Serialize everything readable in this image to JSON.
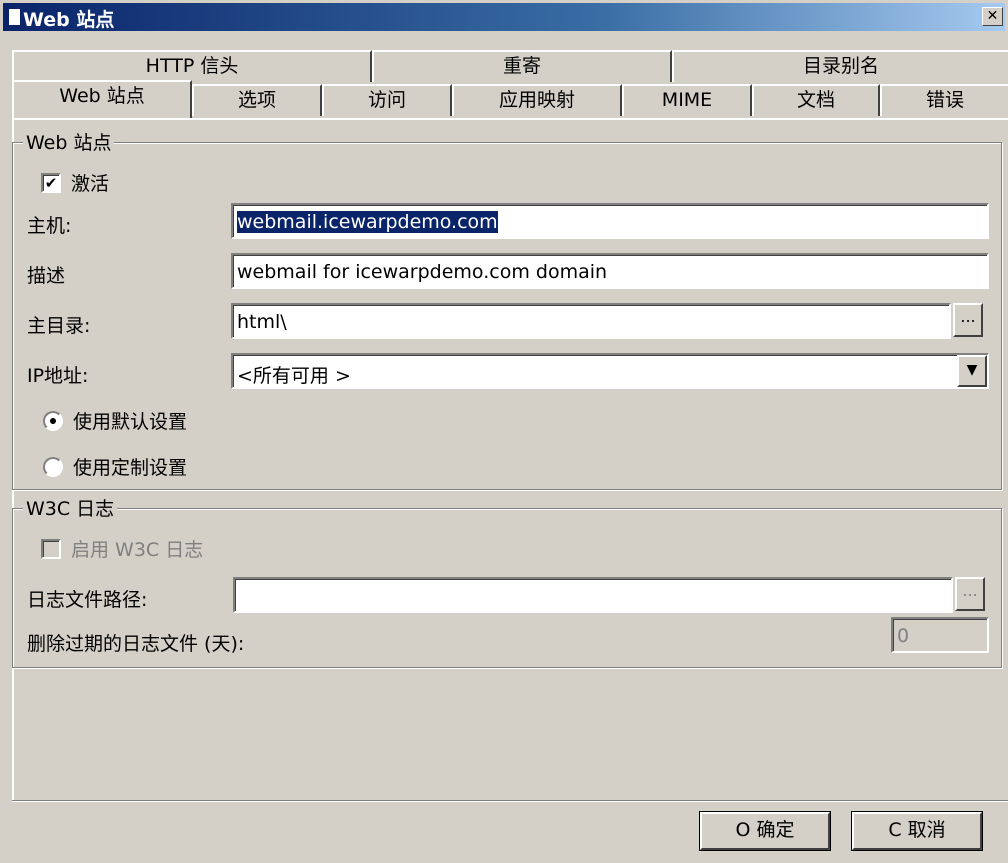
{
  "window": {
    "title": "Web 站点",
    "close_icon": "close-icon"
  },
  "tabs_back": [
    "HTTP 信头",
    "重寄",
    "目录别名"
  ],
  "tabs_front": [
    "Web 站点",
    "选项",
    "访问",
    "应用映射",
    "MIME",
    "文档",
    "错误"
  ],
  "website": {
    "group_title": "Web 站点",
    "activate_label": "激活",
    "activate_checked": true,
    "host_label": "主机:",
    "host_value": "webmail.icewarpdemo.com",
    "desc_label": "描述",
    "desc_value": "webmail for icewarpdemo.com domain",
    "home_label": "主目录:",
    "home_value": "html\\",
    "ip_label": "IP地址:",
    "ip_value": "<所有可用 >",
    "radio_default": "使用默认设置",
    "radio_custom": "使用定制设置",
    "browse_label": "..."
  },
  "w3c": {
    "group_title": "W3C 日志",
    "enable_label": "启用 W3C 日志",
    "path_label": "日志文件路径:",
    "path_value": "",
    "delete_label": "删除过期的日志文件 (天):",
    "delete_value": "0",
    "browse_label": "..."
  },
  "buttons": {
    "ok": "O 确定",
    "cancel": "C 取消"
  }
}
